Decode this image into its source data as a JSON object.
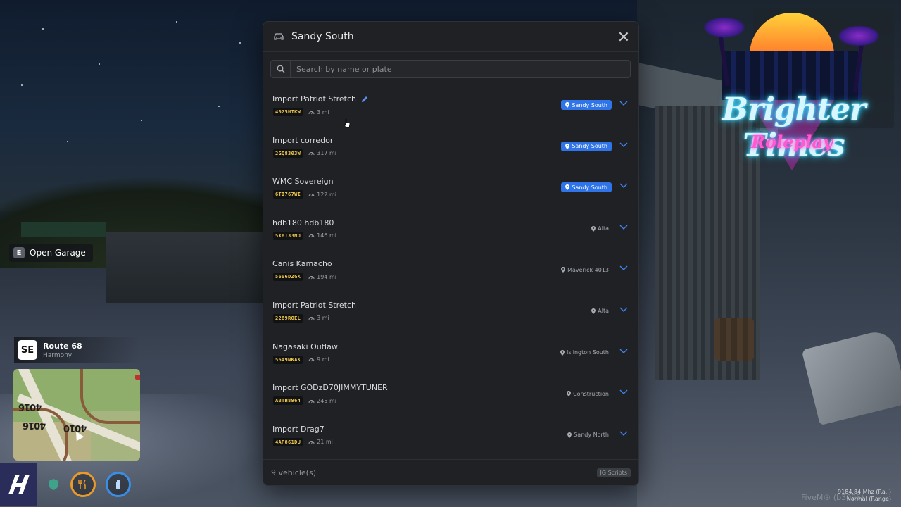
{
  "prompt": {
    "key": "E",
    "label": "Open Garage"
  },
  "street": {
    "direction": "SE",
    "name": "Route 68",
    "zone": "Harmony"
  },
  "minimap": {
    "labels": [
      "4016",
      "4016",
      "4010"
    ]
  },
  "brand": {
    "title": "Brighter Times",
    "subtitle": "Roleplay"
  },
  "garage": {
    "title": "Sandy South",
    "search_placeholder": "Search by name or plate",
    "count_label": "9 vehicle(s)",
    "footer_brand": "JG Scripts",
    "vehicles": [
      {
        "name": "Import Patriot Stretch",
        "plate": "4025HIKW",
        "distance": "3 mi",
        "location": "Sandy South",
        "at_garage": true,
        "editable": true
      },
      {
        "name": "Import corredor",
        "plate": "2GQ8303W",
        "distance": "317 mi",
        "location": "Sandy South",
        "at_garage": true
      },
      {
        "name": "WMC Sovereign",
        "plate": "6TI767WI",
        "distance": "122 mi",
        "location": "Sandy South",
        "at_garage": true
      },
      {
        "name": "hdb180 hdb180",
        "plate": "5XH133MO",
        "distance": "146 mi",
        "location": "Alta",
        "at_garage": false
      },
      {
        "name": "Canis Kamacho",
        "plate": "5606DZGK",
        "distance": "194 mi",
        "location": "Maverick 4013",
        "at_garage": false
      },
      {
        "name": "Import Patriot Stretch",
        "plate": "2289ROEL",
        "distance": "3 mi",
        "location": "Alta",
        "at_garage": false
      },
      {
        "name": "Nagasaki Outlaw",
        "plate": "5649NKAK",
        "distance": "9 mi",
        "location": "Islington South",
        "at_garage": false
      },
      {
        "name": "Import GODzD70JIMMYTUNER",
        "plate": "ABTH8964",
        "distance": "245 mi",
        "location": "Construction",
        "at_garage": false
      },
      {
        "name": "Import Drag7",
        "plate": "4AP861DU",
        "distance": "21 mi",
        "location": "Sandy North",
        "at_garage": false
      }
    ]
  },
  "fivem": {
    "line1": "9184.84 Mhz (Ra..)",
    "line2": "Normal (Range)",
    "watermark": "FiveM® (b3095)"
  },
  "colors": {
    "accent": "#2f74e8",
    "plate_text": "#f2c94c",
    "panel_bg": "#1f2124",
    "food": "#e99a2a",
    "water": "#3a8ee6"
  }
}
